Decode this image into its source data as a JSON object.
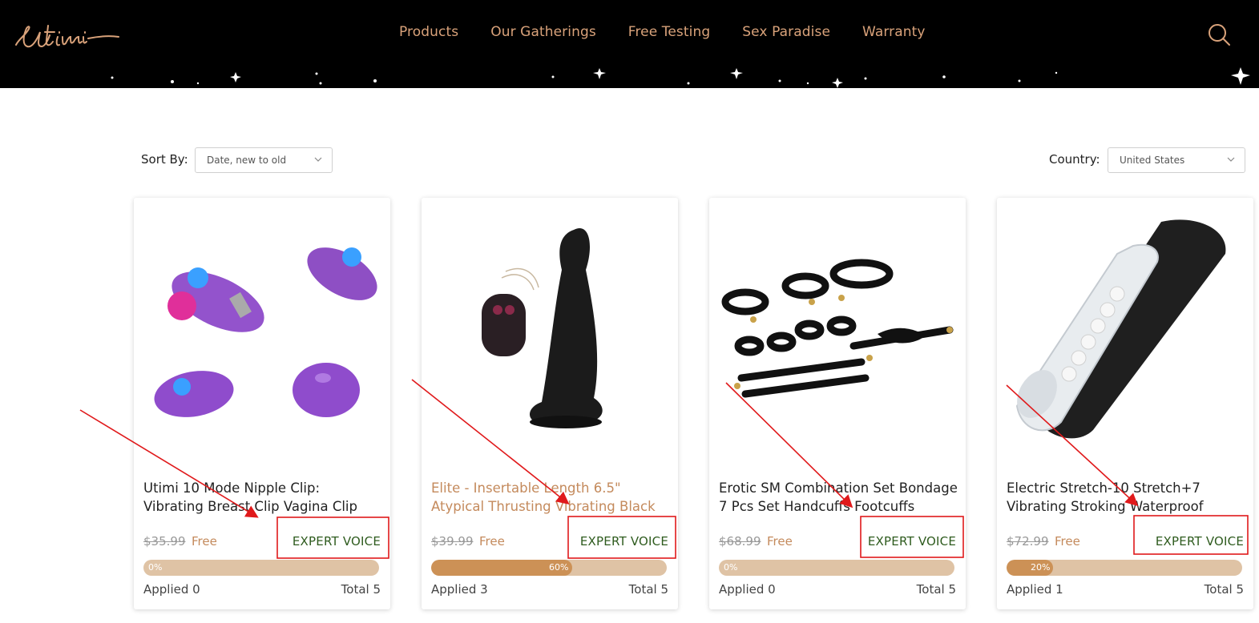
{
  "brand": "Utimi",
  "nav": [
    "Products",
    "Our Gatherings",
    "Free Testing",
    "Sex Paradise",
    "Warranty"
  ],
  "sort": {
    "label": "Sort By:",
    "value": "Date, new to old"
  },
  "country": {
    "label": "Country:",
    "value": "United States"
  },
  "colors": {
    "accent": "#c48a5c",
    "expert": "#2e5b1e",
    "annotation": "#e0191b",
    "bar_bg": "#dfc3a5",
    "bar_fill": "#cc9156"
  },
  "products": [
    {
      "title": "Utimi 10 Mode Nipple Clip: Vibrating Breast Clip Vagina Clip Electric...",
      "old_price": "$35.99",
      "free": "Free",
      "badge": "EXPERT VOICE",
      "progress": "0%",
      "progress_value": 0,
      "applied": "Applied 0",
      "total": "Total 5",
      "image": "purple-nipple-clip-vibrator",
      "highlight": false
    },
    {
      "title": "Elite - Insertable Length 6.5\" Atypical Thrusting Vibrating Black Silicone...",
      "old_price": "$39.99",
      "free": "Free",
      "badge": "EXPERT VOICE",
      "progress": "60%",
      "progress_value": 60,
      "applied": "Applied 3",
      "total": "Total 5",
      "image": "black-silicone-dildo-with-remote",
      "highlight": true
    },
    {
      "title": "Erotic SM Combination Set Bondage 7 Pcs Set Handcuffs Footcuffs Thigh...",
      "old_price": "$68.99",
      "free": "Free",
      "badge": "EXPERT VOICE",
      "progress": "0%",
      "progress_value": 0,
      "applied": "Applied 0",
      "total": "Total 5",
      "image": "black-leather-bondage-set",
      "highlight": false
    },
    {
      "title": "Electric Stretch-10 Stretch+7 Vibrating Stroking Waterproof Masturbator",
      "old_price": "$72.99",
      "free": "Free",
      "badge": "EXPERT VOICE",
      "progress": "20%",
      "progress_value": 20,
      "applied": "Applied 1",
      "total": "Total 5",
      "image": "clear-black-masturbator-cup",
      "highlight": false
    }
  ]
}
